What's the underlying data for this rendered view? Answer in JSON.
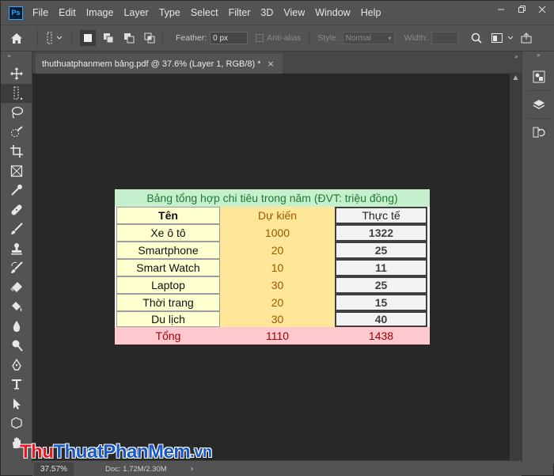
{
  "app": {
    "logo": "Ps",
    "menu": [
      "File",
      "Edit",
      "Image",
      "Layer",
      "Type",
      "Select",
      "Filter",
      "3D",
      "View",
      "Window",
      "Help"
    ],
    "window_controls": [
      "minimize-icon",
      "restore-icon",
      "close-icon"
    ]
  },
  "options_bar": {
    "feather_label": "Feather:",
    "feather_value": "0 px",
    "antialias_label": "Anti-alias",
    "style_label": "Style:",
    "style_value": "Normal",
    "width_label": "Width:"
  },
  "toolbar": {
    "collapse": "»",
    "tools": [
      "move-tool-icon",
      "marquee-tool-icon",
      "lasso-tool-icon",
      "quick-selection-icon",
      "crop-tool-icon",
      "frame-tool-icon",
      "eyedropper-icon",
      "healing-brush-icon",
      "brush-tool-icon",
      "clone-stamp-icon",
      "history-brush-icon",
      "eraser-icon",
      "paint-bucket-icon",
      "blur-tool-icon",
      "dodge-tool-icon",
      "pen-tool-icon",
      "type-tool-icon",
      "path-selection-icon",
      "shape-tool-icon",
      "hand-tool-icon"
    ]
  },
  "document": {
    "tab_title": "thuthuatphanmem bảng.pdf @ 37.6% (Layer 1, RGB/8) *",
    "tab_close": "×"
  },
  "table": {
    "title": "Bảng tổng hợp chi tiêu trong năm (ĐVT: triệu đồng)",
    "headers": [
      "Tên",
      "Dự kiến",
      "Thực tế"
    ],
    "rows": [
      {
        "name": "Xe ô tô",
        "plan": "1000",
        "actual": "1322"
      },
      {
        "name": "Smartphone",
        "plan": "20",
        "actual": "25"
      },
      {
        "name": "Smart Watch",
        "plan": "10",
        "actual": "11"
      },
      {
        "name": "Laptop",
        "plan": "30",
        "actual": "25"
      },
      {
        "name": "Thời trang",
        "plan": "20",
        "actual": "15"
      },
      {
        "name": "Du lịch",
        "plan": "30",
        "actual": "40"
      }
    ],
    "total": {
      "name": "Tổng",
      "plan": "1110",
      "actual": "1438"
    },
    "colors": {
      "title_bg": "#c6efce",
      "title_fg": "#1f7a2f",
      "plan_bg": "#ffe699",
      "plan_fg": "#9c5700",
      "name_bg": "#ffffd0",
      "actual_bg": "#f2f2f2",
      "actual_fg": "#3f3f3f",
      "total_bg": "#ffc7ce",
      "total_fg": "#9c0006"
    }
  },
  "right_panel": {
    "collapse": "»",
    "buttons": [
      "color-panel-icon",
      "layers-panel-icon",
      "history-panel-icon"
    ]
  },
  "status": {
    "zoom": "37.57%",
    "doc_info": "Doc: 1.72M/2.30M",
    "arrow": "›"
  },
  "watermark": {
    "part1": "Thu",
    "part2": "ThuatPhanMem",
    "part3": ".vn"
  }
}
